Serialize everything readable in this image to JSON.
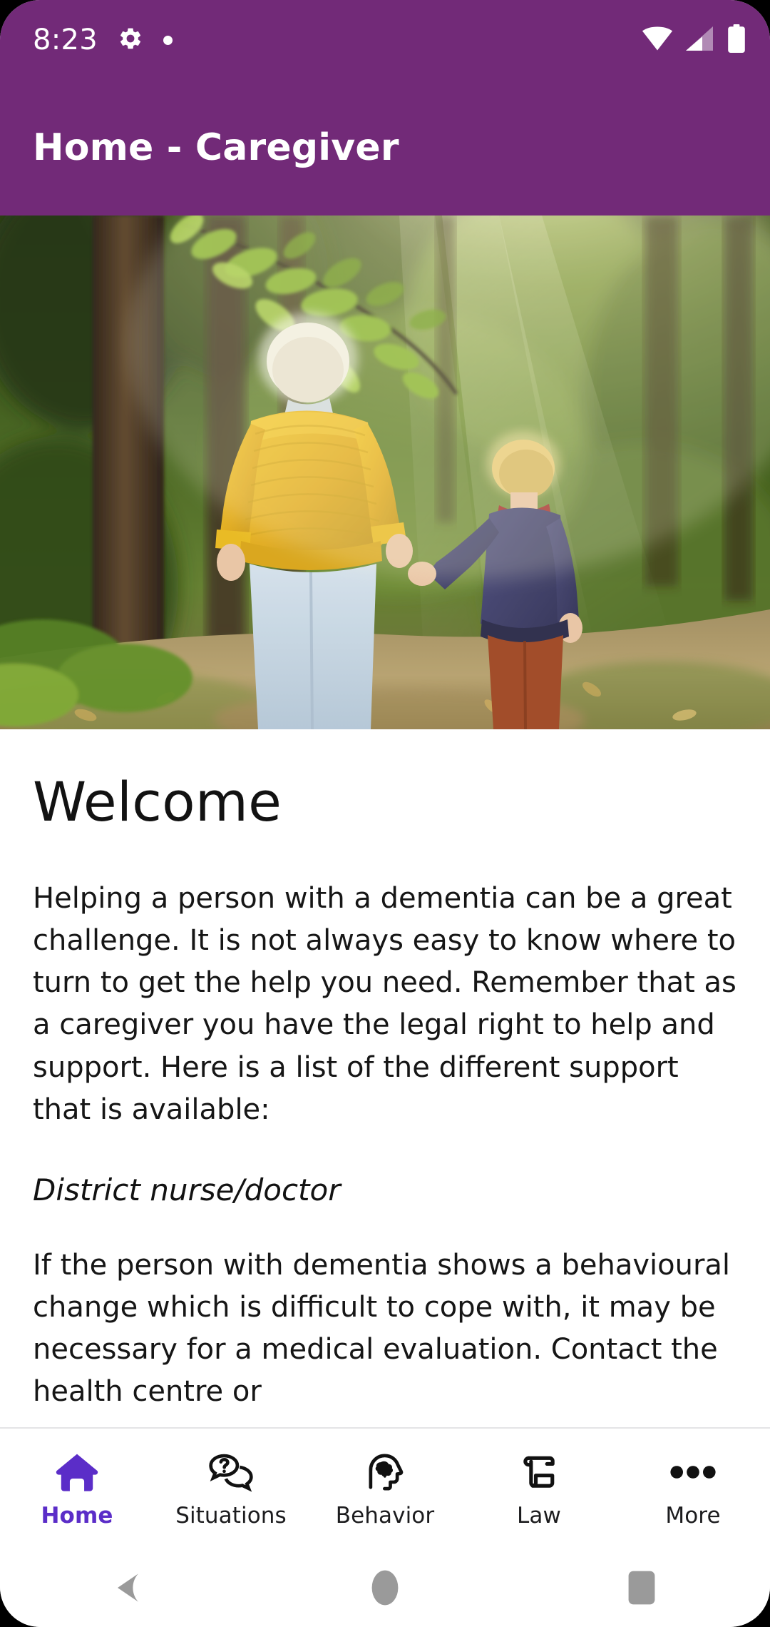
{
  "status_bar": {
    "time": "8:23",
    "icons": [
      "gear-icon",
      "notification-dot",
      "wifi-icon",
      "cell-signal-icon",
      "battery-icon"
    ]
  },
  "app_bar": {
    "title": "Home - Caregiver",
    "background_color": "#722A78",
    "text_color": "#FFFFFF"
  },
  "hero": {
    "alt": "Elderly woman in yellow cardigan holding hands with a young child walking on a sunlit forest path"
  },
  "content": {
    "heading": "Welcome",
    "paragraph1": "Helping a person with a dementia can be a great challenge. It is not always easy to know where to turn to get the help you need. Remember that as a caregiver you have the legal right to help and support. Here is a list of the different support that is available:",
    "subheading": "District nurse/doctor",
    "paragraph2": "If the person with dementia shows a behavioural change which is difficult to cope with, it may be necessary for a medical evaluation. Contact the health centre or"
  },
  "bottom_nav": {
    "active_color": "#5B2DC8",
    "inactive_color": "#1C1C1E",
    "items": [
      {
        "label": "Home",
        "icon": "home-icon",
        "active": true
      },
      {
        "label": "Situations",
        "icon": "speech-bubbles-question-icon",
        "active": false
      },
      {
        "label": "Behavior",
        "icon": "head-brain-icon",
        "active": false
      },
      {
        "label": "Law",
        "icon": "scroll-icon",
        "active": false
      },
      {
        "label": "More",
        "icon": "ellipsis-icon",
        "active": false
      }
    ]
  },
  "system_nav": {
    "buttons": [
      "back-button",
      "home-button",
      "recents-button"
    ],
    "color": "#9A9A9A"
  }
}
